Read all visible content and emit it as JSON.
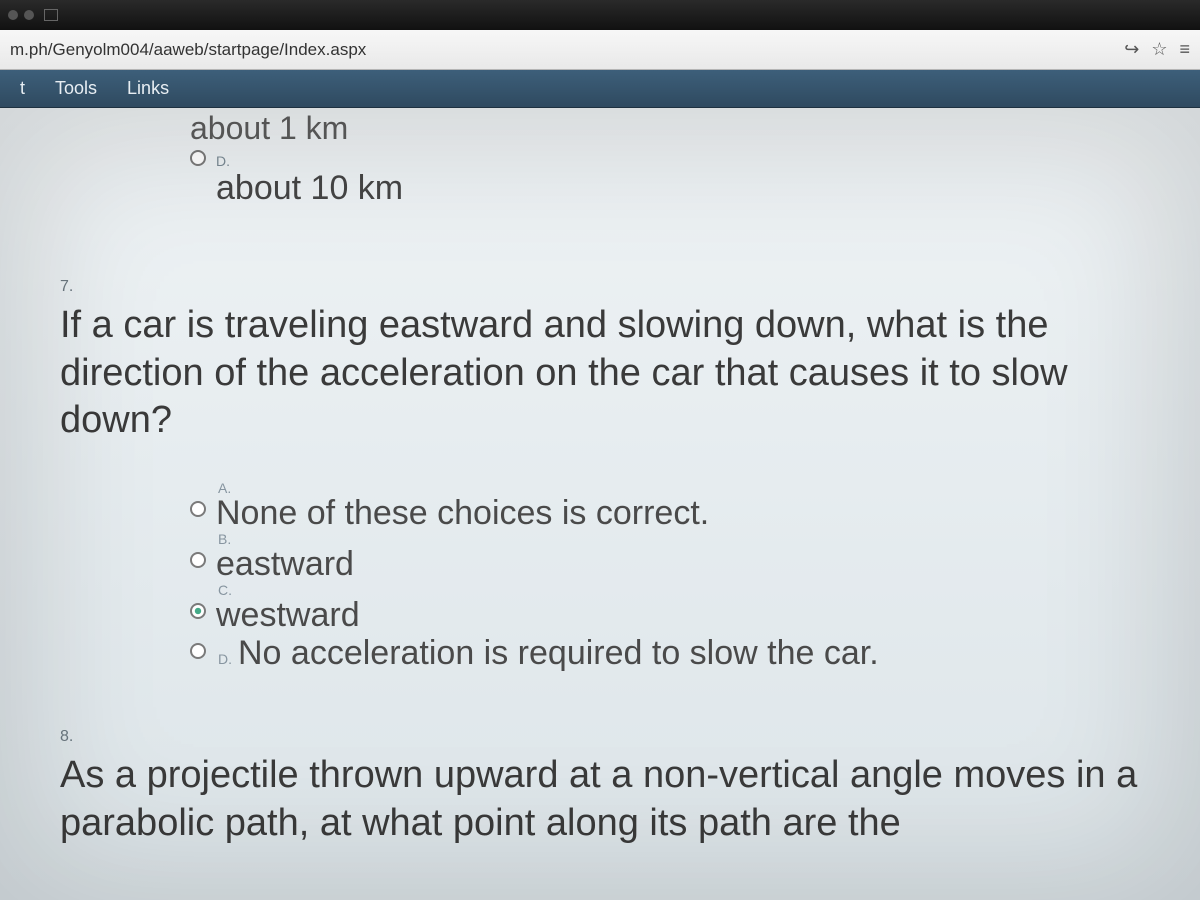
{
  "titlebar": {
    "present": true
  },
  "address": {
    "url": "m.ph/Genyolm004/aaweb/startpage/Index.aspx",
    "icons": {
      "share": "share-icon",
      "fav": "star-icon",
      "read": "reading-icon"
    }
  },
  "menubar": {
    "items": [
      {
        "label": "t"
      },
      {
        "label": "Tools"
      },
      {
        "label": "Links"
      }
    ]
  },
  "q6_partial": {
    "choice_c_text": "about 1 km",
    "choice_d_letter": "D.",
    "choice_d_text": "about 10 km"
  },
  "q7": {
    "num": "7.",
    "text": "If a car is traveling eastward and slowing down, what is the direction of the acceleration on the car that causes it to slow down?",
    "choices": [
      {
        "letter": "A.",
        "text": "None of these choices is correct."
      },
      {
        "letter": "B.",
        "text": "eastward"
      },
      {
        "letter": "C.",
        "text": "westward"
      },
      {
        "letter": "D.",
        "text": "No acceleration is required to slow the car."
      }
    ]
  },
  "q8": {
    "num": "8.",
    "text": "As a projectile thrown upward at a non-vertical angle moves in a parabolic path, at what point along its path are the"
  }
}
